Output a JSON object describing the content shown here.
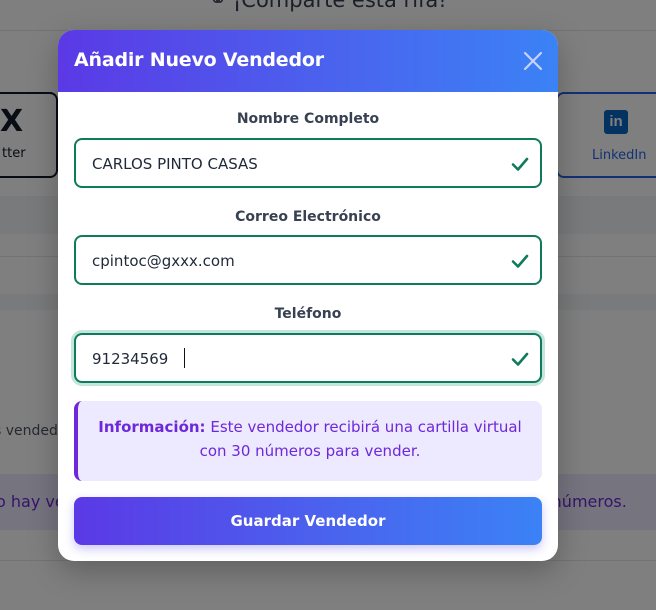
{
  "background": {
    "share_text": "¡Comparte esta rifa!",
    "twitter_label": "Twitter",
    "twitter_visible_label": "tter",
    "linkedin_label": "LinkedIn",
    "sellers_fragment": "s vendede",
    "empty_left": "o hay ve",
    "empty_right": "r números."
  },
  "modal": {
    "title": "Añadir Nuevo Vendedor",
    "close_icon": "close-icon",
    "fields": [
      {
        "label": "Nombre Completo",
        "value": "CARLOS PINTO CASAS"
      },
      {
        "label": "Correo Electrónico",
        "value": "cpintoc@gxxx.com"
      },
      {
        "label": "Teléfono",
        "value": "91234569"
      }
    ],
    "info_title": "Información:",
    "info_text": "Este vendedor recibirá una cartilla virtual con 30 números para vender.",
    "save_label": "Guardar Vendedor"
  },
  "colors": {
    "header_gradient_start": "#5b39e6",
    "header_gradient_end": "#3b82f6",
    "valid_green": "#0f7b5a",
    "info_text": "#6d28d9",
    "info_bg": "#ede9fe"
  }
}
